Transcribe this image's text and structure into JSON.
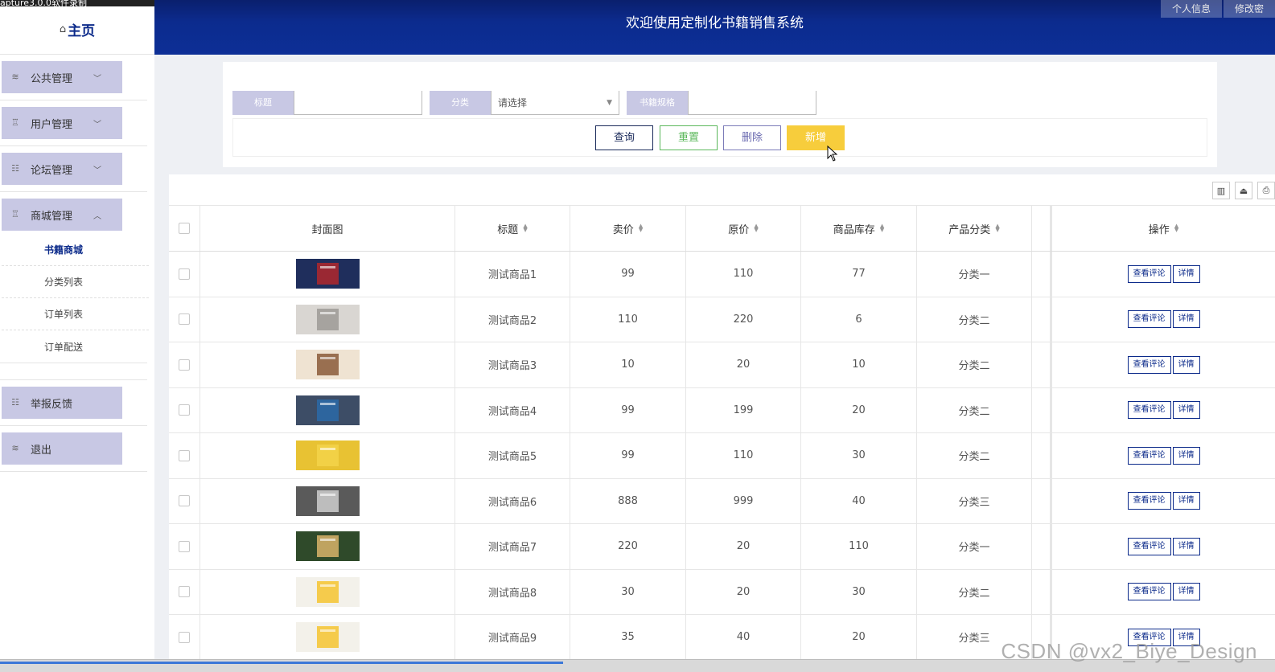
{
  "capture_strip": "apture3.0.0软件录制",
  "header": {
    "title": "欢迎使用定制化书籍销售系统",
    "actions": [
      "个人信息",
      "修改密"
    ]
  },
  "sidebar": {
    "home": "主页",
    "menus": [
      {
        "label": "公共管理",
        "icon": "layers-icon",
        "expanded": false
      },
      {
        "label": "用户管理",
        "icon": "user-icon",
        "expanded": false
      },
      {
        "label": "论坛管理",
        "icon": "list-icon",
        "expanded": false
      },
      {
        "label": "商城管理",
        "icon": "user-icon",
        "expanded": true,
        "items": [
          "书籍商城",
          "分类列表",
          "订单列表",
          "订单配送"
        ],
        "active": "书籍商城"
      },
      {
        "label": "举报反馈",
        "icon": "list-icon",
        "expanded": false
      },
      {
        "label": "退出",
        "icon": "layers-icon",
        "expanded": false
      }
    ]
  },
  "search": {
    "title_label": "标题",
    "title_value": "",
    "category_label": "分类",
    "category_value": "请选择",
    "spec_label": "书籍规格",
    "spec_value": "",
    "buttons": {
      "query": "查询",
      "reset": "重置",
      "delete": "删除",
      "add": "新增"
    }
  },
  "table": {
    "columns": [
      "封面图",
      "标题",
      "卖价",
      "原价",
      "商品库存",
      "产品分类",
      "操作"
    ],
    "row_actions": {
      "comments": "查看评论",
      "detail": "详情"
    },
    "rows": [
      {
        "title": "测试商品1",
        "sell": "99",
        "orig": "110",
        "stock": "77",
        "cat": "分类一",
        "cover": [
          "#1f2e5c",
          "#b0272b"
        ]
      },
      {
        "title": "测试商品2",
        "sell": "110",
        "orig": "220",
        "stock": "6",
        "cat": "分类二",
        "cover": [
          "#d9d6d2",
          "#9c9a96"
        ]
      },
      {
        "title": "测试商品3",
        "sell": "10",
        "orig": "20",
        "stock": "10",
        "cat": "分类二",
        "cover": [
          "#efe3d2",
          "#8a5a3a"
        ]
      },
      {
        "title": "测试商品4",
        "sell": "99",
        "orig": "199",
        "stock": "20",
        "cat": "分类二",
        "cover": [
          "#3d4d66",
          "#2a6aa8"
        ]
      },
      {
        "title": "测试商品5",
        "sell": "99",
        "orig": "110",
        "stock": "30",
        "cat": "分类二",
        "cover": [
          "#e8c233",
          "#f3d34a"
        ]
      },
      {
        "title": "测试商品6",
        "sell": "888",
        "orig": "999",
        "stock": "40",
        "cat": "分类三",
        "cover": [
          "#5a5a5a",
          "#cfcfcf"
        ]
      },
      {
        "title": "测试商品7",
        "sell": "220",
        "orig": "20",
        "stock": "110",
        "cat": "分类一",
        "cover": [
          "#2f4a2a",
          "#d8b36a"
        ]
      },
      {
        "title": "测试商品8",
        "sell": "30",
        "orig": "20",
        "stock": "30",
        "cat": "分类二",
        "cover": [
          "#f3f1ea",
          "#f4c430"
        ]
      },
      {
        "title": "测试商品9",
        "sell": "35",
        "orig": "40",
        "stock": "20",
        "cat": "分类三",
        "cover": [
          "#f3f1ea",
          "#f4c430"
        ]
      }
    ]
  },
  "watermark": "CSDN @vx2_Biye_Design",
  "colors": {
    "header": "#0c2b8e",
    "menu": "#c8c8e4",
    "accent_add": "#f7cd3c",
    "accent_reset": "#5cb85c"
  }
}
